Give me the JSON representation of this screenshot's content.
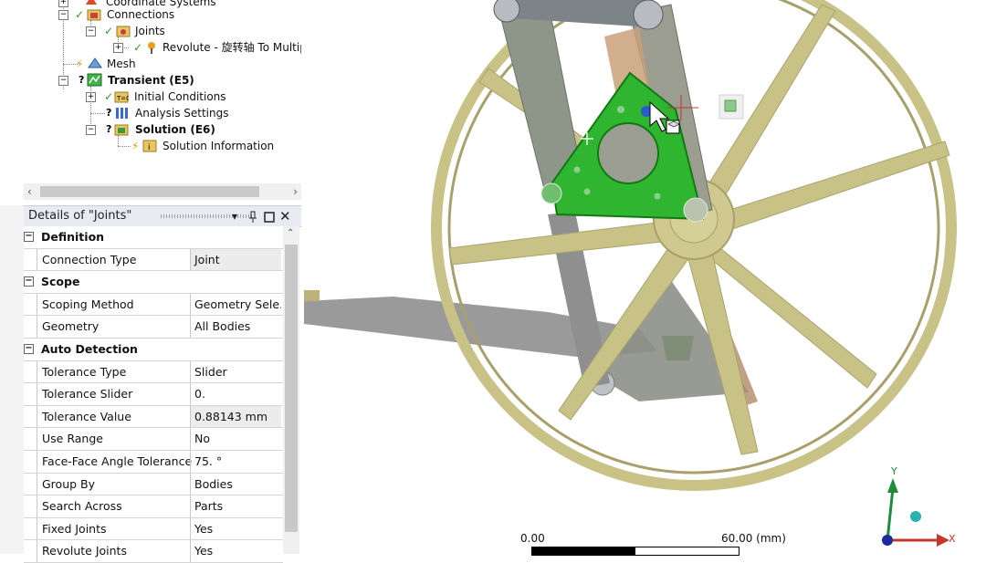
{
  "tree": {
    "rows": [
      {
        "label": "Coordinate Systems",
        "bold": false
      },
      {
        "label": "Connections",
        "bold": false
      },
      {
        "label": "Joints",
        "bold": false
      },
      {
        "label": "Revolute - 旋转轴 To Multip",
        "bold": false
      },
      {
        "label": "Mesh",
        "bold": false
      },
      {
        "label": "Transient (E5)",
        "bold": true
      },
      {
        "label": "Initial Conditions",
        "bold": false
      },
      {
        "label": "Analysis Settings",
        "bold": false
      },
      {
        "label": "Solution (E6)",
        "bold": true
      },
      {
        "label": "Solution Information",
        "bold": false
      }
    ]
  },
  "details": {
    "title": "Details of \"Joints\"",
    "pin_icon": "pin-icon",
    "close_icon": "close-icon",
    "sections": [
      {
        "name": "Definition",
        "rows": [
          {
            "prop": "Connection Type",
            "value": "Joint",
            "shaded": true
          }
        ]
      },
      {
        "name": "Scope",
        "rows": [
          {
            "prop": "Scoping Method",
            "value": "Geometry Sele...",
            "shaded": false
          },
          {
            "prop": "Geometry",
            "value": "All Bodies",
            "shaded": false
          }
        ]
      },
      {
        "name": "Auto Detection",
        "rows": [
          {
            "prop": "Tolerance Type",
            "value": "Slider",
            "shaded": false
          },
          {
            "prop": "Tolerance Slider",
            "value": "0.",
            "shaded": false
          },
          {
            "prop": "Tolerance Value",
            "value": "0.88143 mm",
            "shaded": true
          },
          {
            "prop": "Use Range",
            "value": "No",
            "shaded": false
          },
          {
            "prop": "Face-Face Angle Tolerance",
            "value": "75. °",
            "shaded": false
          },
          {
            "prop": "Group By",
            "value": "Bodies",
            "shaded": false
          },
          {
            "prop": "Search Across",
            "value": "Parts",
            "shaded": false
          },
          {
            "prop": "Fixed Joints",
            "value": "Yes",
            "shaded": false
          },
          {
            "prop": "Revolute Joints",
            "value": "Yes",
            "shaded": false
          }
        ]
      }
    ]
  },
  "viewport": {
    "scale_min": "0.00",
    "scale_max": "60.00 (mm)",
    "axis_y": "Y",
    "axis_x": "X",
    "colors": {
      "wheel": "#c8c287",
      "plate": "#25b82a",
      "link": "#8e9589"
    }
  }
}
